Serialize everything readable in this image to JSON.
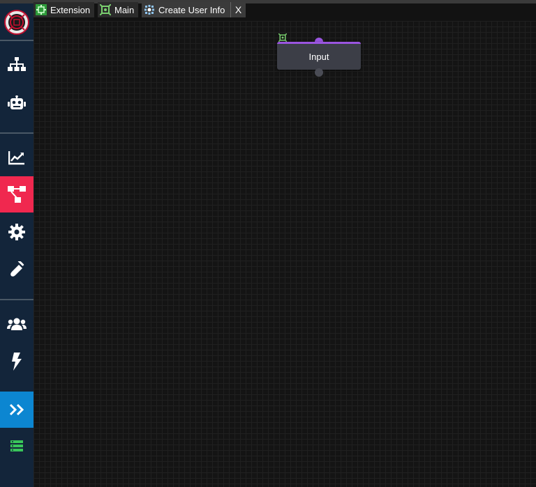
{
  "tabs": [
    {
      "label": "Extension",
      "icon": "extension-icon",
      "active": false
    },
    {
      "label": "Main",
      "icon": "flow-icon",
      "active": false
    },
    {
      "label": "Create User Info",
      "icon": "subflow-icon",
      "active": true
    }
  ],
  "close_label": "X",
  "node": {
    "label": "Input",
    "icon": "flow-icon"
  },
  "sidebar": {
    "items": [
      {
        "name": "hierarchy",
        "icon": "sitemap-icon"
      },
      {
        "name": "robot",
        "icon": "robot-icon"
      },
      {
        "name": "analytics",
        "icon": "chart-line-icon"
      },
      {
        "name": "flows",
        "icon": "flow-diagram-icon",
        "active": true
      },
      {
        "name": "settings",
        "icon": "gear-icon"
      },
      {
        "name": "test",
        "icon": "test-tube-icon"
      },
      {
        "name": "users",
        "icon": "users-icon"
      },
      {
        "name": "actions",
        "icon": "bolt-icon"
      },
      {
        "name": "expand",
        "icon": "chevron-double-right-icon",
        "active": true
      },
      {
        "name": "servers",
        "icon": "server-icon"
      }
    ]
  },
  "colors": {
    "active_red": "#f0284f",
    "active_blue": "#0c86d1",
    "node_accent": "#9a55e0",
    "sidebar_bg": "#13253a"
  }
}
